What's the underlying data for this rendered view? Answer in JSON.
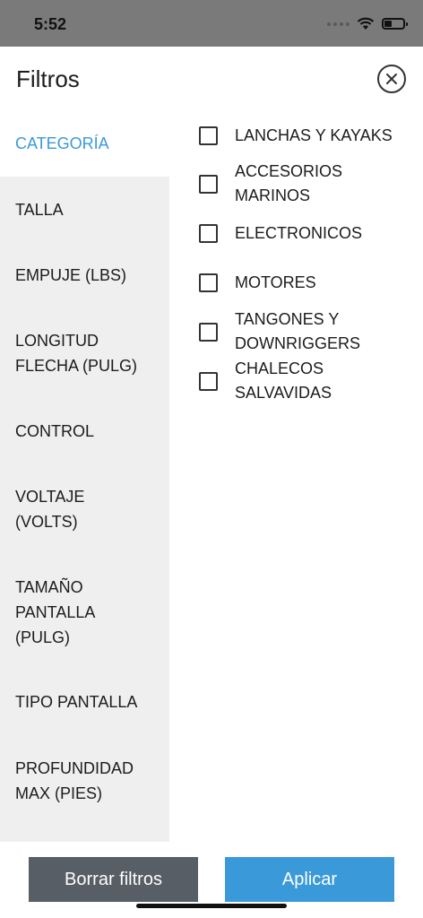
{
  "status_bar": {
    "time": "5:52"
  },
  "header": {
    "title": "Filtros"
  },
  "sidebar": {
    "items": [
      {
        "label": "CATEGORÍA"
      },
      {
        "label": "TALLA"
      },
      {
        "label": "EMPUJE (LBS)"
      },
      {
        "label": "LONGITUD FLECHA (PULG)"
      },
      {
        "label": "CONTROL"
      },
      {
        "label": "VOLTAJE (VOLTS)"
      },
      {
        "label": "TAMAÑO PANTALLA (PULG)"
      },
      {
        "label": "TIPO PANTALLA"
      },
      {
        "label": "PROFUNDIDAD MAX (PIES)"
      }
    ]
  },
  "options": [
    {
      "label": "LANCHAS Y KAYAKS",
      "checked": false
    },
    {
      "label": "ACCESORIOS MARINOS",
      "checked": false
    },
    {
      "label": "ELECTRONICOS",
      "checked": false
    },
    {
      "label": "MOTORES",
      "checked": false
    },
    {
      "label": "TANGONES Y DOWNRIGGERS",
      "checked": false
    },
    {
      "label": "CHALECOS SALVAVIDAS",
      "checked": false
    }
  ],
  "footer": {
    "clear_label": "Borrar filtros",
    "apply_label": "Aplicar"
  },
  "colors": {
    "accent": "#3a9ad9",
    "clear_button": "#575e66",
    "sidebar_bg": "#efefef"
  }
}
